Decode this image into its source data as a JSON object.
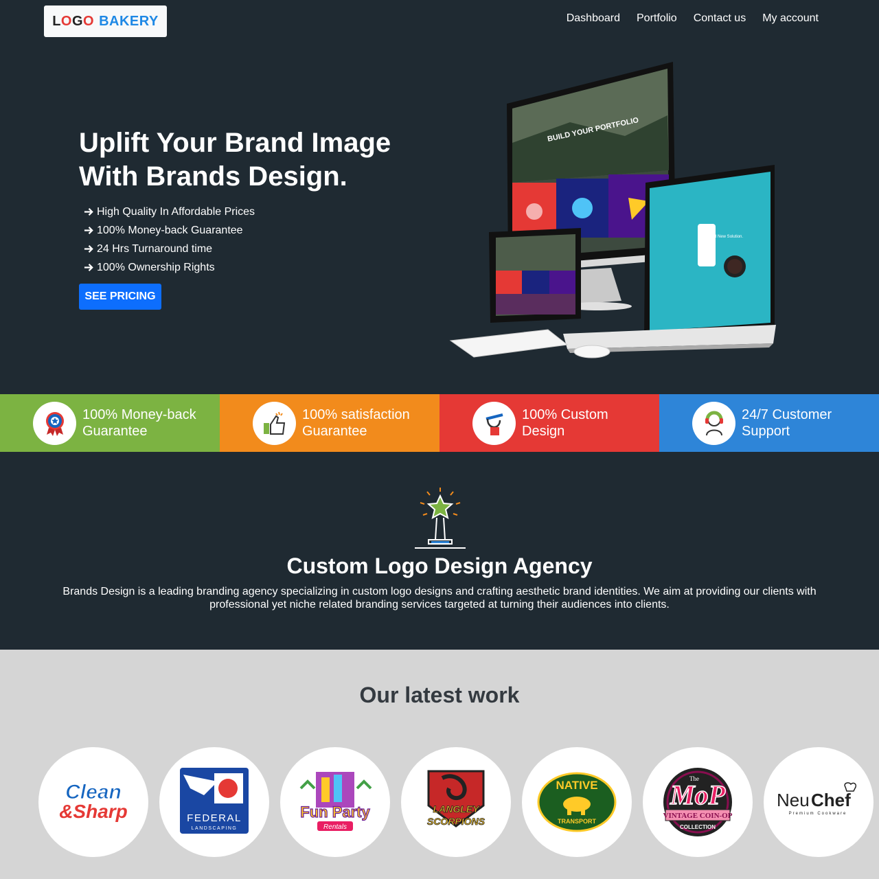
{
  "header": {
    "logo_parts": [
      "L",
      "O",
      "G",
      "O",
      "BAKERY"
    ],
    "nav": [
      "Dashboard",
      "Portfolio",
      "Contact us",
      "My account"
    ]
  },
  "hero": {
    "title_line1": "Uplift Your Brand Image",
    "title_line2": "With Brands Design.",
    "features": [
      "High Quality In Affordable Prices",
      "100% Money-back Guarantee",
      "24 Hrs Turnaround time",
      "100% Ownership Rights"
    ],
    "cta_label": "SEE PRICING",
    "mockup": {
      "monitor_text": "BUILD YOUR PORTFOLIO",
      "laptop_text": "A Brand New Solution."
    }
  },
  "strip": [
    {
      "line1": "100% Money-back",
      "line2": "Guarantee",
      "color": "#7cb342",
      "icon": "award-badge-icon"
    },
    {
      "line1": "100% satisfaction",
      "line2": "Guarantee",
      "color": "#f28b1c",
      "icon": "thumbs-up-icon"
    },
    {
      "line1": "100% Custom",
      "line2": "Design",
      "color": "#e53935",
      "icon": "pen-design-icon"
    },
    {
      "line1": "24/7 Customer",
      "line2": "Support",
      "color": "#2e85d8",
      "icon": "headset-support-icon"
    }
  ],
  "agency": {
    "title": "Custom Logo Design Agency",
    "text": "Brands Design is a leading branding agency specializing in custom logo designs and crafting aesthetic brand identities. We aim at providing our clients with professional yet niche related branding services targeted at turning their audiences into clients."
  },
  "work": {
    "title": "Our latest work",
    "logos": {
      "clean_sharp": [
        "Clean",
        "&Sharp"
      ],
      "federal": [
        "FEDERAL",
        "LANDSCAPING"
      ],
      "fun_party": [
        "Fun Party",
        "Rentals"
      ],
      "langley": [
        "LANGLEY",
        "SCORPIONS"
      ],
      "native": [
        "NATIVE",
        "TRANSPORT"
      ],
      "mop": [
        "The",
        "MoP",
        "VINTAGE COIN-OP",
        "COLLECTION"
      ],
      "neuchef": [
        "Neu",
        "Chef",
        "Premium Cookware"
      ]
    }
  },
  "colors": {
    "bg_dark": "#1f2a32",
    "accent_blue": "#0d6efd",
    "work_bg": "#d5d5d5"
  }
}
